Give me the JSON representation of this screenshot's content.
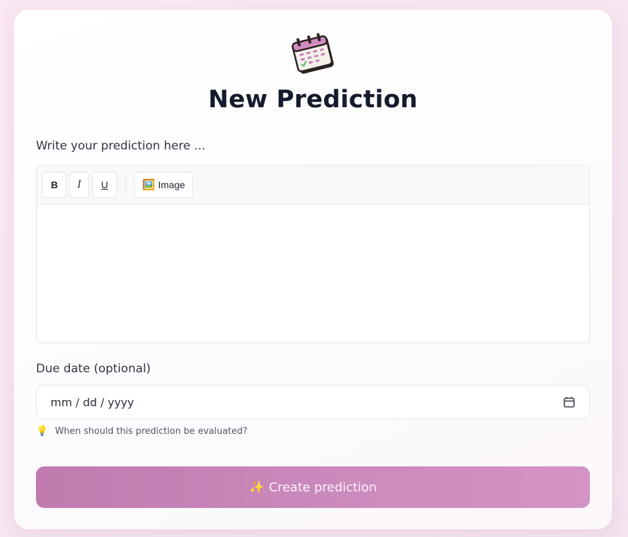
{
  "page": {
    "title": "New Prediction",
    "logo_icon": "calendar-icon"
  },
  "prediction": {
    "label": "Write your prediction here ...",
    "toolbar": {
      "bold_label": "B",
      "italic_label": "I",
      "underline_label": "U",
      "image_label": "Image",
      "image_icon": "🖼️"
    },
    "value": ""
  },
  "due_date": {
    "label": "Due date (optional)",
    "placeholder": "mm / dd / yyyy",
    "hint_icon": "💡",
    "hint": "When should this prediction be evaluated?"
  },
  "submit": {
    "icon": "✨",
    "label": "Create prediction"
  },
  "colors": {
    "accent_start": "#c07aae",
    "accent_end": "#d394c5",
    "title": "#141b2d"
  }
}
